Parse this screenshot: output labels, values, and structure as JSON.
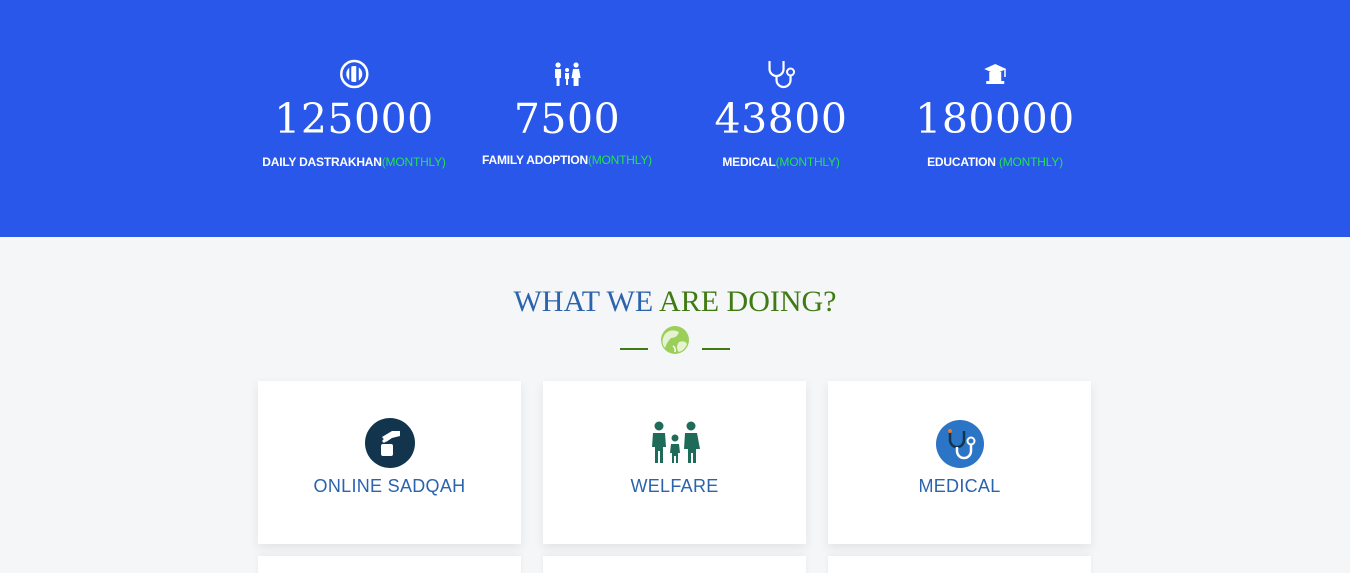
{
  "stats": [
    {
      "icon": "plate-cutlery-icon",
      "value": "125000",
      "label": "DAILY DASTRAKHAN",
      "suffix": "(MONTHLY)"
    },
    {
      "icon": "family-icon",
      "value": "7500",
      "label": "FAMILY ADOPTION",
      "suffix": "(MONTHLY)"
    },
    {
      "icon": "stethoscope-icon",
      "value": "43800",
      "label": "MEDICAL",
      "suffix": "(MONTHLY)"
    },
    {
      "icon": "graduation-cap-icon",
      "value": "180000",
      "label": "EDUCATION ",
      "suffix": "(MONTHLY)"
    }
  ],
  "section": {
    "title_part1": "WHAT WE ",
    "title_part2": "ARE DOING?"
  },
  "cards": [
    {
      "icon": "sadqah-hand-icon",
      "label": "ONLINE SADQAH"
    },
    {
      "icon": "family-icon",
      "label": "WELFARE"
    },
    {
      "icon": "stethoscope-icon",
      "label": "MEDICAL"
    }
  ],
  "colors": {
    "band": "#2857e9",
    "accent_green": "#23e34f",
    "title_blue": "#2b63ad",
    "title_green": "#3f7a12",
    "card_teal": "#1d6b58",
    "card_dark": "#12354d"
  }
}
